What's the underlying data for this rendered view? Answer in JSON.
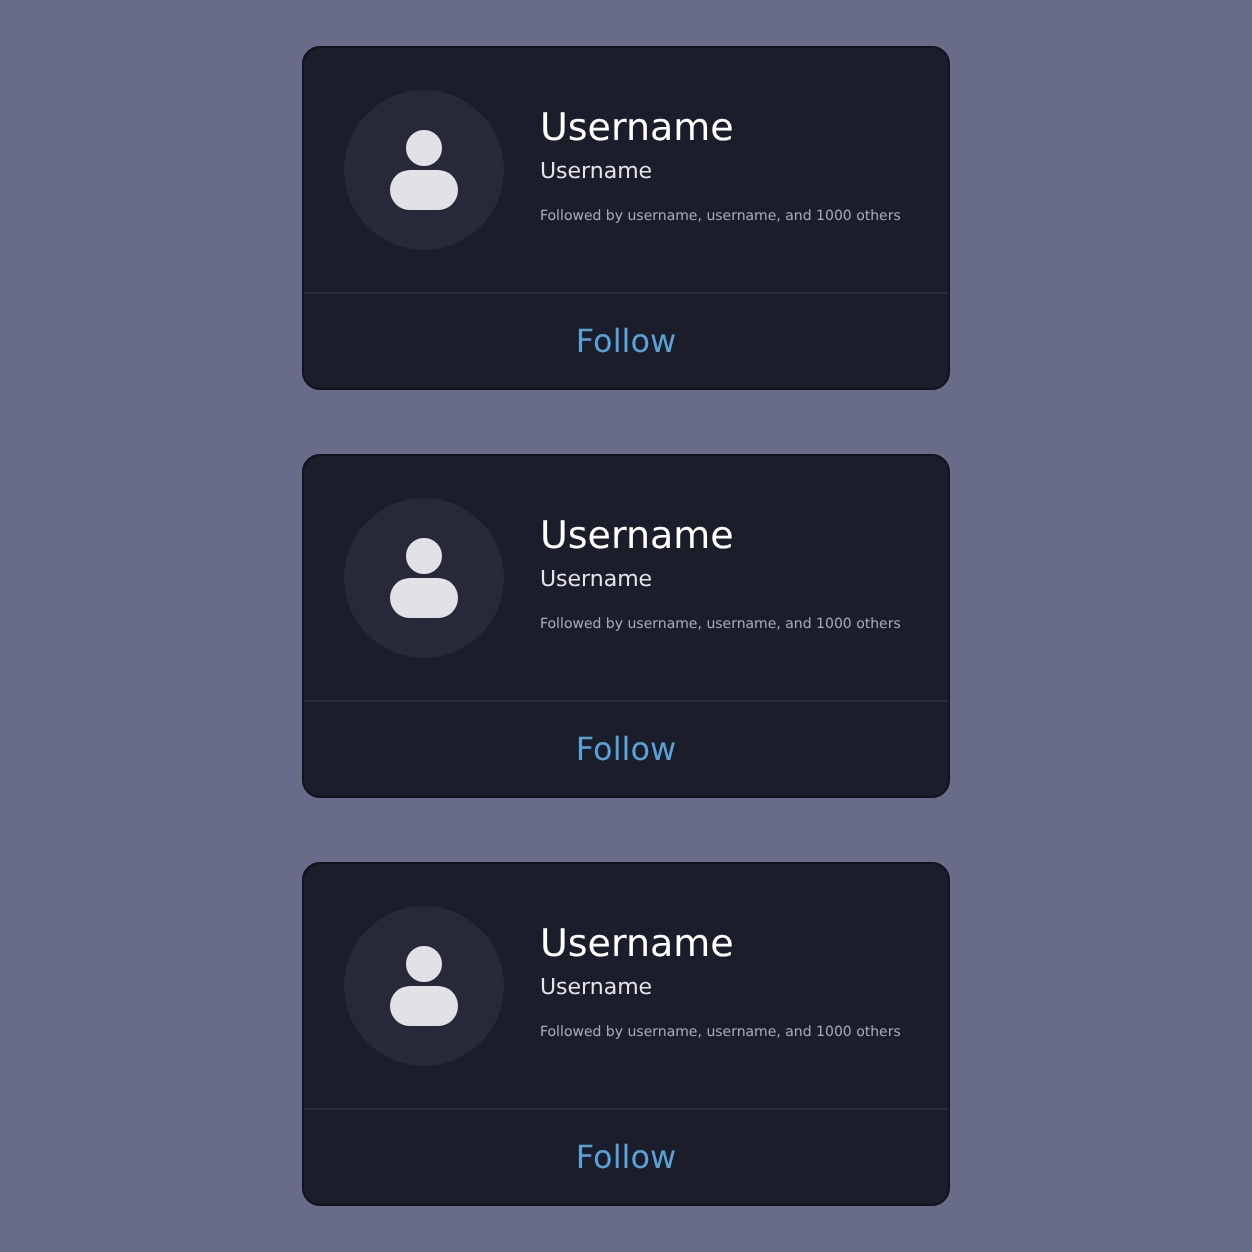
{
  "cards": [
    {
      "display_name": "Username",
      "handle": "Username",
      "followers": "Followed by username, username, and 1000 others",
      "action": "Follow"
    },
    {
      "display_name": "Username",
      "handle": "Username",
      "followers": "Followed by username, username, and 1000 others",
      "action": "Follow"
    },
    {
      "display_name": "Username",
      "handle": "Username",
      "followers": "Followed by username, username, and 1000 others",
      "action": "Follow"
    }
  ]
}
